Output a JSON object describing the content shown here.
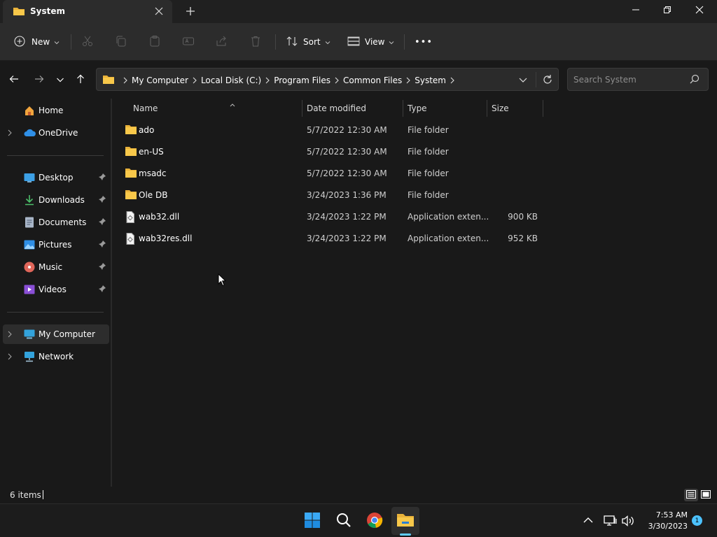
{
  "window": {
    "tab_title": "System",
    "new_tab_label": "+",
    "controls": [
      "minimize-icon",
      "restore-icon",
      "close-icon"
    ]
  },
  "toolbar": {
    "new_label": "New",
    "sort_label": "Sort",
    "view_label": "View",
    "more_label": "•••",
    "disabled_actions": [
      "cut-icon",
      "copy-icon",
      "paste-icon",
      "rename-icon",
      "share-icon",
      "delete-icon"
    ]
  },
  "address": {
    "breadcrumbs": [
      "My Computer",
      "Local Disk (C:)",
      "Program Files",
      "Common Files",
      "System"
    ]
  },
  "search": {
    "placeholder": "Search System"
  },
  "nav": {
    "items": [
      {
        "label": "Home",
        "icon": "home-icon",
        "expandable": false,
        "pinned": false
      },
      {
        "label": "OneDrive",
        "icon": "cloud-icon",
        "expandable": true,
        "pinned": false
      },
      {
        "label": "Desktop",
        "icon": "desktop-icon",
        "expandable": false,
        "pinned": true
      },
      {
        "label": "Downloads",
        "icon": "download-icon",
        "expandable": false,
        "pinned": true
      },
      {
        "label": "Documents",
        "icon": "documents-icon",
        "expandable": false,
        "pinned": true
      },
      {
        "label": "Pictures",
        "icon": "pictures-icon",
        "expandable": false,
        "pinned": true
      },
      {
        "label": "Music",
        "icon": "music-icon",
        "expandable": false,
        "pinned": true
      },
      {
        "label": "Videos",
        "icon": "videos-icon",
        "expandable": false,
        "pinned": true
      },
      {
        "label": "My Computer",
        "icon": "computer-icon",
        "expandable": true,
        "pinned": false,
        "selected": true
      },
      {
        "label": "Network",
        "icon": "network-icon",
        "expandable": true,
        "pinned": false
      }
    ]
  },
  "files": {
    "columns": [
      "Name",
      "Date modified",
      "Type",
      "Size"
    ],
    "rows": [
      {
        "name": "ado",
        "date": "5/7/2022 12:30 AM",
        "type": "File folder",
        "size": "",
        "icon": "folder-icon"
      },
      {
        "name": "en-US",
        "date": "5/7/2022 12:30 AM",
        "type": "File folder",
        "size": "",
        "icon": "folder-icon"
      },
      {
        "name": "msadc",
        "date": "5/7/2022 12:30 AM",
        "type": "File folder",
        "size": "",
        "icon": "folder-icon"
      },
      {
        "name": "Ole DB",
        "date": "3/24/2023 1:36 PM",
        "type": "File folder",
        "size": "",
        "icon": "folder-icon"
      },
      {
        "name": "wab32.dll",
        "date": "3/24/2023 1:22 PM",
        "type": "Application exten...",
        "size": "900 KB",
        "icon": "dll-file-icon"
      },
      {
        "name": "wab32res.dll",
        "date": "3/24/2023 1:22 PM",
        "type": "Application exten...",
        "size": "952 KB",
        "icon": "dll-file-icon"
      }
    ]
  },
  "status": {
    "items_count": "6 items"
  },
  "taskbar": {
    "apps": [
      "start-icon",
      "search-icon",
      "chrome-icon",
      "file-explorer-icon"
    ],
    "time": "7:53 AM",
    "date": "3/30/2023",
    "notifications": "1"
  },
  "colors": {
    "background": "#191919",
    "chrome": "#2c2c2c",
    "folder": "#f8c84a",
    "accent": "#60cdff"
  }
}
